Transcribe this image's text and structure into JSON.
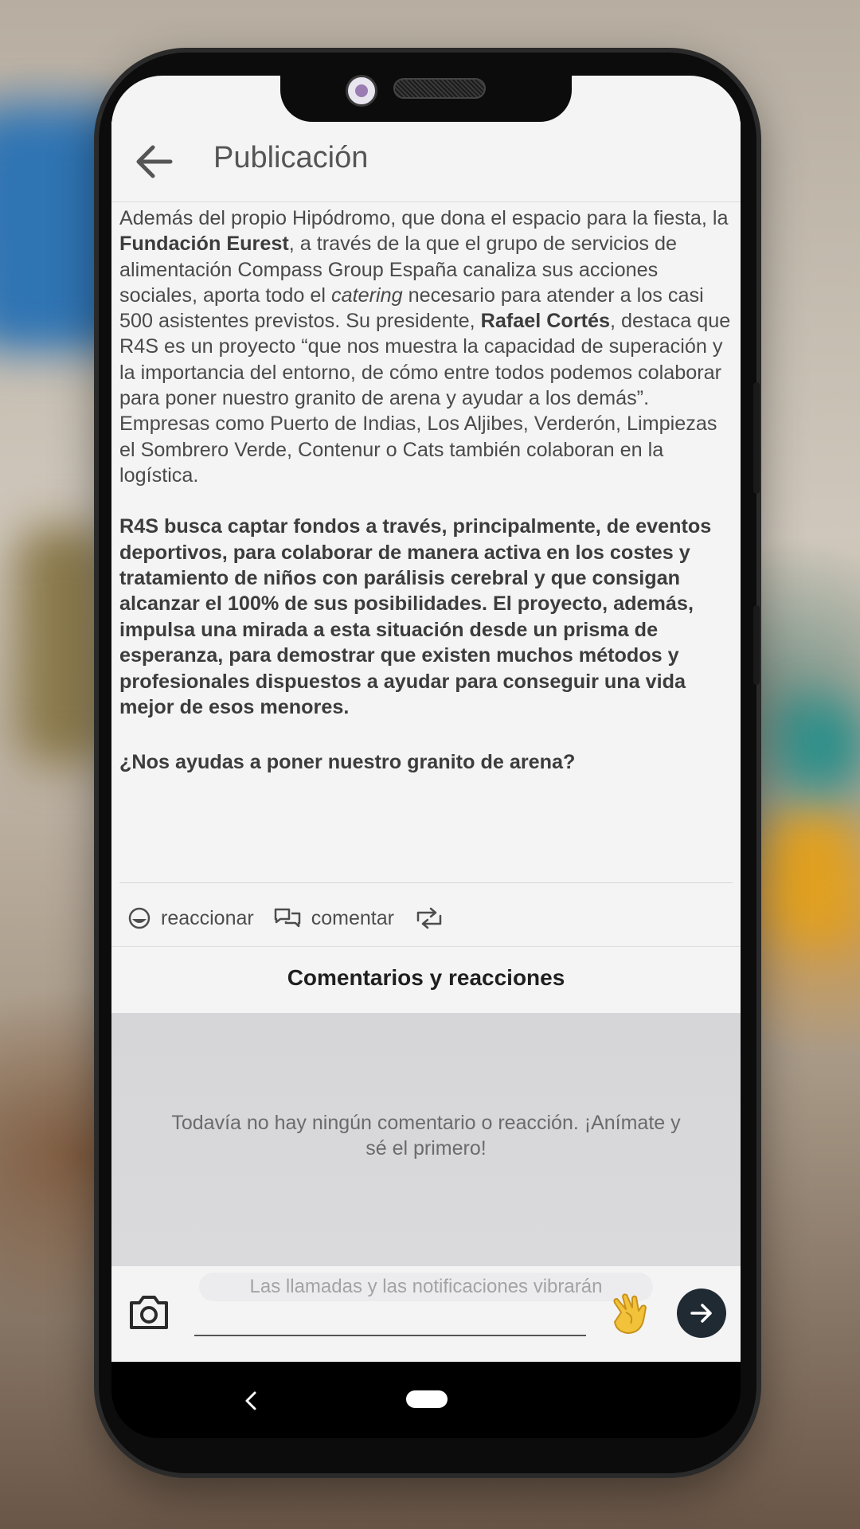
{
  "app_bar": {
    "title": "Publicación",
    "back_icon": "arrow-left-icon"
  },
  "article": {
    "p1_a": "Además del propio Hipódromo, que dona el espacio para la fiesta, la ",
    "p1_bold1": "Fundación Eurest",
    "p1_b": ", a través de la que el grupo de servicios de alimentación Compass Group España canaliza sus acciones sociales, aporta todo el ",
    "p1_italic": "catering",
    "p1_c": " necesario para atender a los casi 500 asistentes previstos. Su presidente, ",
    "p1_bold2": "Rafael Cortés",
    "p1_d": ", destaca que R4S es un proyecto “que nos muestra la capacidad de superación y la importancia del entorno, de cómo entre todos podemos colaborar para poner nuestro granito de arena y ayudar a los demás”. Empresas como Puerto de Indias, Los Aljibes, Verderón, Limpiezas el Sombrero Verde, Contenur o Cats también colaboran en la logística.",
    "p2": "R4S busca captar fondos a través, principalmente, de eventos deportivos, para colaborar de manera activa en los costes y tratamiento de niños con parálisis cerebral y que consigan alcanzar el 100% de sus posibilidades. El proyecto, además, impulsa una mirada a esta situación desde un prisma de esperanza, para demostrar que existen muchos métodos y profesionales dispuestos a ayudar para conseguir una vida mejor de esos menores.",
    "p3": "¿Nos ayudas a poner nuestro granito de arena?"
  },
  "actions": {
    "react_label": "reaccionar",
    "react_icon": "smiley-icon",
    "comment_label": "comentar",
    "comment_icon": "speech-bubbles-icon",
    "share_icon": "repost-icon"
  },
  "comments": {
    "title": "Comentarios y reacciones",
    "empty_message": "Todavía no hay ningún comentario o reacción. ¡Anímate y sé el primero!"
  },
  "composer": {
    "toast": "Las llamadas y las notificaciones vibrarán",
    "camera_icon": "camera-icon",
    "clap_icon": "clapping-hands-icon",
    "send_icon": "arrow-right-icon"
  },
  "colors": {
    "send_button": "#1f2a33",
    "screen_bg": "#f4f4f5"
  }
}
